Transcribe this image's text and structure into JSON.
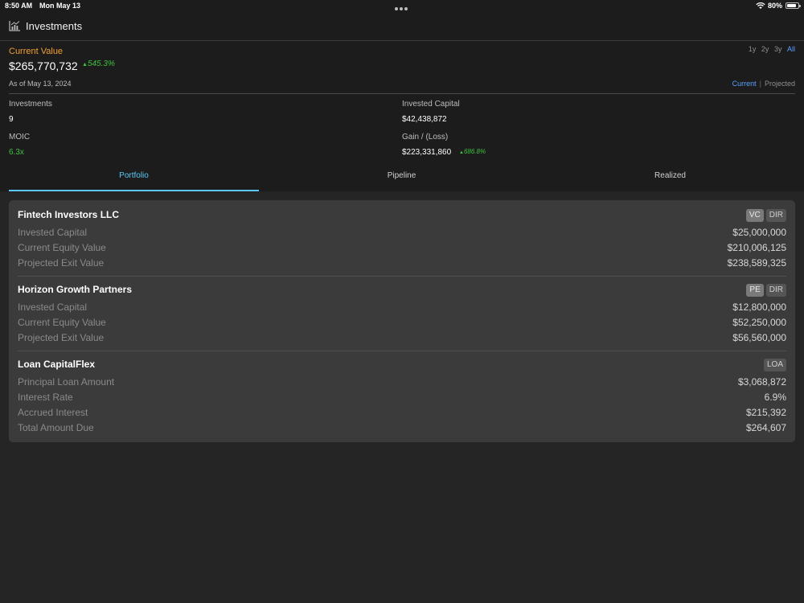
{
  "status_bar": {
    "time": "8:50 AM",
    "date": "Mon May 13",
    "battery": "80%"
  },
  "header": {
    "title": "Investments"
  },
  "summary": {
    "current_value_label": "Current Value",
    "current_value": "$265,770,732",
    "current_value_change": "545.3%",
    "as_of": "As of May 13, 2024",
    "ranges": [
      "1y",
      "2y",
      "3y",
      "All"
    ],
    "views": {
      "current": "Current",
      "separator": "|",
      "projected": "Projected"
    },
    "investments_label": "Investments",
    "investments_count": "9",
    "invested_capital_label": "Invested Capital",
    "invested_capital_value": "$42,438,872",
    "moic_label": "MOIC",
    "moic_value": "6.3x",
    "gain_label": "Gain / (Loss)",
    "gain_value": "$223,331,860",
    "gain_change": "686.8%"
  },
  "tabs": [
    "Portfolio",
    "Pipeline",
    "Realized"
  ],
  "investments": [
    {
      "name": "Fintech Investors LLC",
      "badges": [
        "VC",
        "DIR"
      ],
      "rows": [
        {
          "label": "Invested Capital",
          "value": "$25,000,000"
        },
        {
          "label": "Current Equity Value",
          "value": "$210,006,125"
        },
        {
          "label": "Projected Exit Value",
          "value": "$238,589,325"
        }
      ]
    },
    {
      "name": "Horizon Growth Partners",
      "badges": [
        "PE",
        "DIR"
      ],
      "rows": [
        {
          "label": "Invested Capital",
          "value": "$12,800,000"
        },
        {
          "label": "Current Equity Value",
          "value": "$52,250,000"
        },
        {
          "label": "Projected Exit Value",
          "value": "$56,560,000"
        }
      ]
    },
    {
      "name": "Loan CapitalFlex",
      "badges": [
        "LOA"
      ],
      "rows": [
        {
          "label": "Principal Loan Amount",
          "value": "$3,068,872"
        },
        {
          "label": "Interest Rate",
          "value": "6.9%"
        },
        {
          "label": "Accrued Interest",
          "value": "$215,392"
        },
        {
          "label": "Total Amount Due",
          "value": "$264,607"
        }
      ]
    }
  ],
  "colors": {
    "accent_orange": "#f0a030",
    "positive_green": "#3ec13e",
    "link_blue": "#5aa0ff",
    "tab_active": "#5ac8fa"
  }
}
